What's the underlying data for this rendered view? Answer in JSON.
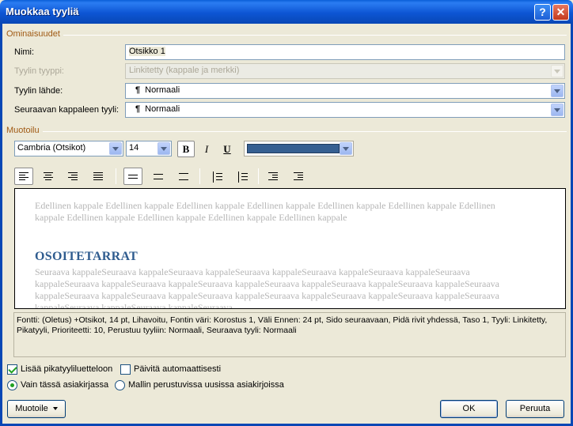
{
  "window": {
    "title": "Muokkaa tyyliä"
  },
  "properties": {
    "section_label": "Ominaisuudet",
    "name_label": "Nimi:",
    "name_value": "Otsikko 1",
    "type_label": "Tyylin tyyppi:",
    "type_value": "Linkitetty (kappale ja merkki)",
    "based_on_label": "Tyylin lähde:",
    "based_on_value": "Normaali",
    "next_style_label": "Seuraavan kappaleen tyyli:",
    "next_style_value": "Normaali"
  },
  "formatting": {
    "section_label": "Muotoilu",
    "font": "Cambria (Otsikot)",
    "size": "14",
    "bold": "B",
    "italic": "I",
    "underline": "U",
    "font_color": "#365f91"
  },
  "preview": {
    "previous_text": "Edellinen kappale Edellinen kappale Edellinen kappale Edellinen kappale Edellinen kappale Edellinen kappale Edellinen kappale Edellinen kappale Edellinen kappale Edellinen kappale Edellinen kappale",
    "heading": "OSOITETARRAT",
    "next_text": "Seuraava kappaleSeuraava kappaleSeuraava kappaleSeuraava kappaleSeuraava kappaleSeuraava kappaleSeuraava kappaleSeuraava kappaleSeuraava kappaleSeuraava kappaleSeuraava kappaleSeuraava kappaleSeuraava kappaleSeuraava kappaleSeuraava kappaleSeuraava kappaleSeuraava kappaleSeuraava kappaleSeuraava kappaleSeuraava kappaleSeuraava kappaleSeuraava kappaleSeuraava kappaleSeuraava"
  },
  "description": "Fontti: (Oletus) +Otsikot, 14 pt, Lihavoitu, Fontin väri: Korostus 1, Väli Ennen:  24 pt, Sido seuraavaan, Pidä rivit yhdessä, Taso 1, Tyyli: Linkitetty, Pikatyyli, Prioriteetti: 10, Perustuu tyyliin: Normaali, Seuraava tyyli: Normaali",
  "options": {
    "add_quick_styles": "Lisää pikatyyliluetteloon",
    "auto_update": "Päivitä automaattisesti",
    "only_this_doc": "Vain tässä asiakirjassa",
    "new_docs": "Mallin perustuvissa uusissa asiakirjoissa"
  },
  "buttons": {
    "format": "Muotoile",
    "ok": "OK",
    "cancel": "Peruuta"
  }
}
